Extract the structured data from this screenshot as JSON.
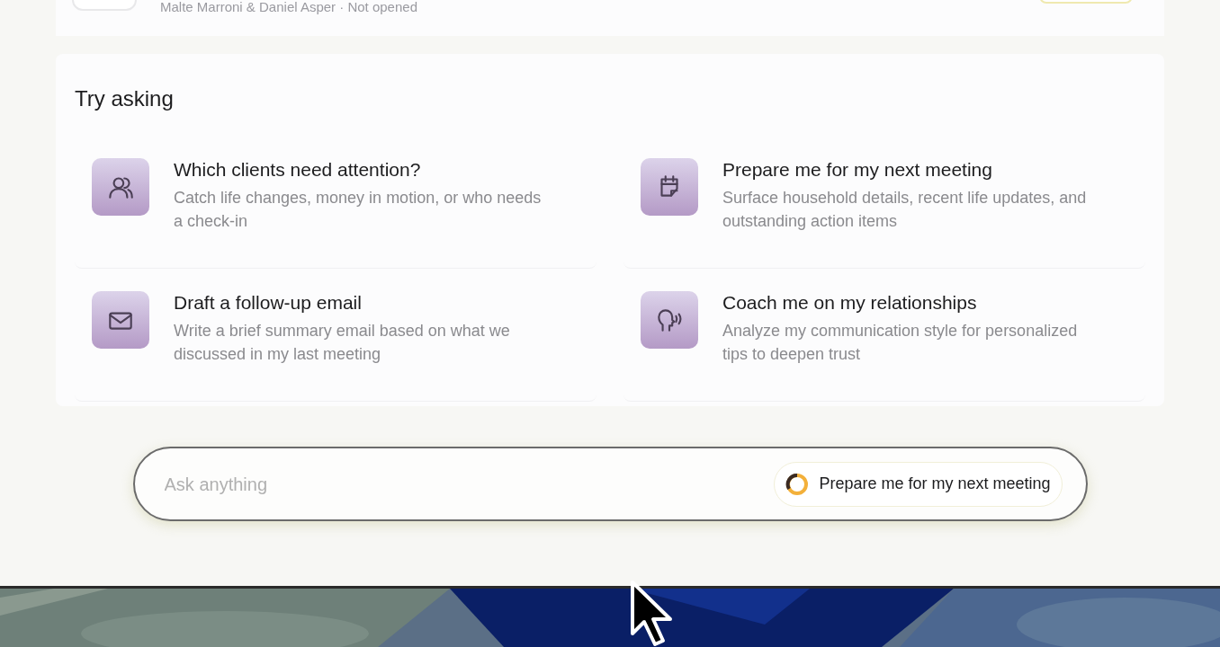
{
  "previous_item": {
    "subtitle": "Malte Marroni & Daniel Asper · Not opened"
  },
  "suggestions": {
    "heading": "Try asking",
    "items": [
      {
        "kind": "people",
        "title": "Which clients need attention?",
        "description": "Catch life changes, money in motion, or who needs a check-in"
      },
      {
        "kind": "calendar",
        "title": "Prepare me for my next meeting",
        "description": "Surface household details, recent life updates, and outstanding action items"
      },
      {
        "kind": "mail",
        "title": "Draft a follow-up email",
        "description": "Write a brief summary email based on what we discussed in my last meeting"
      },
      {
        "kind": "voice",
        "title": "Coach me on my relationships",
        "description": "Analyze my communication style for personalized tips to deepen trust"
      }
    ]
  },
  "prompt_bar": {
    "placeholder": "Ask anything",
    "chip": "Prepare me for my next meeting"
  }
}
